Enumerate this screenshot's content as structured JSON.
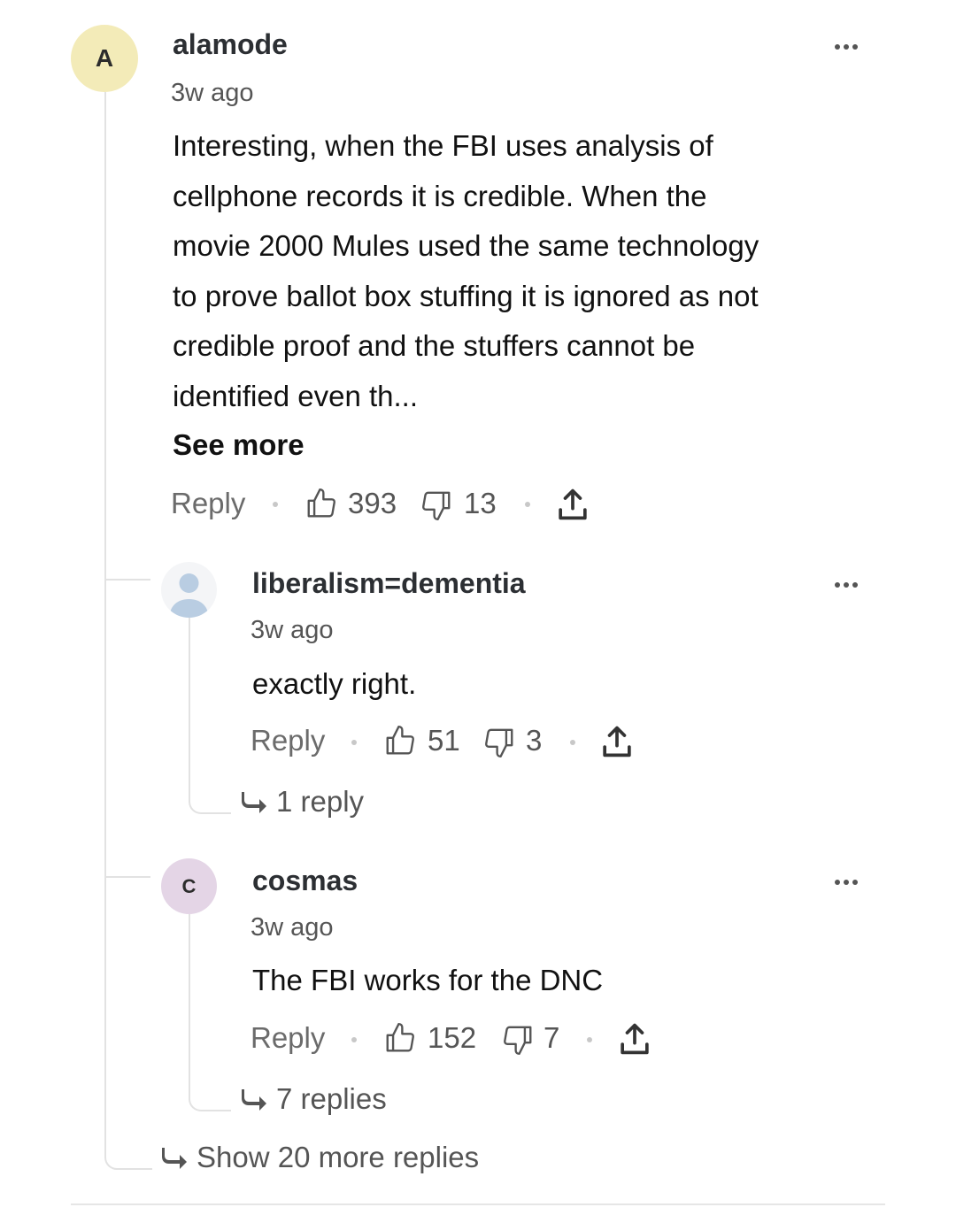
{
  "comment": {
    "avatar_letter": "A",
    "avatar_color": "#f3ebb8",
    "author": "alamode",
    "time": "3w ago",
    "body_lines": [
      "Interesting, when the FBI uses analysis of",
      "cellphone records it is credible.  When the",
      "movie 2000 Mules used the same technology",
      "to prove ballot box stuffing it is ignored as not",
      "credible proof and the stuffers cannot be",
      "identified even th..."
    ],
    "see_more": "See more",
    "reply_label": "Reply",
    "likes": "393",
    "dislikes": "13"
  },
  "replies": [
    {
      "avatar_icon": "person-placeholder-icon",
      "author": "liberalism=dementia",
      "time": "3w ago",
      "body": "exactly right.",
      "reply_label": "Reply",
      "likes": "51",
      "dislikes": "3",
      "replies_link": "1 reply"
    },
    {
      "avatar_letter": "C",
      "avatar_color": "#e4d5e6",
      "author": "cosmas",
      "time": "3w ago",
      "body": "The FBI works for the DNC",
      "reply_label": "Reply",
      "likes": "152",
      "dislikes": "7",
      "replies_link": "7 replies"
    }
  ],
  "show_more_replies": "Show 20 more replies",
  "colors": {
    "thread_line": "#e2e2e2",
    "muted_text": "#555555"
  }
}
